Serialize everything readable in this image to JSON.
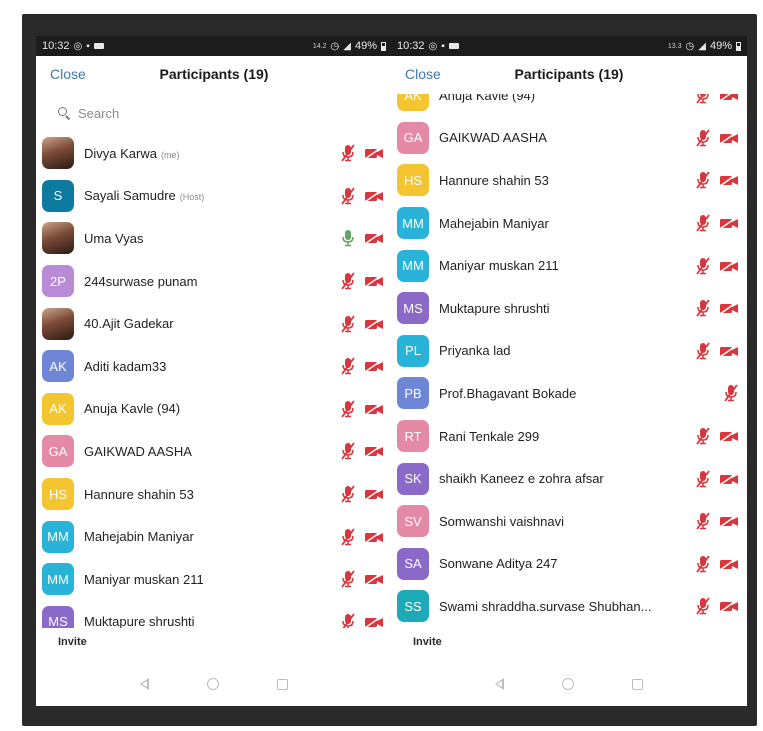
{
  "screens": [
    {
      "status": {
        "time": "10:32",
        "right_small": "14.2",
        "battery": "49%"
      },
      "header": {
        "close_label": "Close",
        "title": "Participants (19)"
      },
      "search": {
        "placeholder": "Search"
      },
      "participants": [
        {
          "name": "Divya Karwa",
          "role": "(me)",
          "initials": "",
          "photo": true,
          "color": "#8b5a46",
          "mic": "muted",
          "video": "off"
        },
        {
          "name": "Sayali Samudre",
          "role": "(Host)",
          "initials": "S",
          "photo": false,
          "color": "#0e7aa0",
          "mic": "muted",
          "video": "off"
        },
        {
          "name": "Uma Vyas",
          "role": "",
          "initials": "",
          "photo": true,
          "color": "#9a6a50",
          "mic": "on",
          "video": "off"
        },
        {
          "name": "244surwase punam",
          "role": "",
          "initials": "2P",
          "photo": false,
          "color": "#b98bd6",
          "mic": "muted",
          "video": "off"
        },
        {
          "name": "40.Ajit Gadekar",
          "role": "",
          "initials": "",
          "photo": true,
          "color": "#6b6b6b",
          "mic": "muted",
          "video": "off"
        },
        {
          "name": "Aditi kadam33",
          "role": "",
          "initials": "AK",
          "photo": false,
          "color": "#6d86d6",
          "mic": "muted",
          "video": "off"
        },
        {
          "name": "Anuja Kavle (94)",
          "role": "",
          "initials": "AK",
          "photo": false,
          "color": "#f2c531",
          "mic": "muted",
          "video": "off"
        },
        {
          "name": "GAIKWAD AASHA",
          "role": "",
          "initials": "GA",
          "photo": false,
          "color": "#e58aa6",
          "mic": "muted",
          "video": "off"
        },
        {
          "name": "Hannure shahin 53",
          "role": "",
          "initials": "HS",
          "photo": false,
          "color": "#f2c531",
          "mic": "muted",
          "video": "off"
        },
        {
          "name": "Mahejabin Maniyar",
          "role": "",
          "initials": "MM",
          "photo": false,
          "color": "#29b3d9",
          "mic": "muted",
          "video": "off"
        },
        {
          "name": "Maniyar muskan 211",
          "role": "",
          "initials": "MM",
          "photo": false,
          "color": "#29b3d9",
          "mic": "muted",
          "video": "off"
        },
        {
          "name": "Muktapure shrushti",
          "role": "",
          "initials": "MS",
          "photo": false,
          "color": "#8a69c9",
          "mic": "muted",
          "video": "off"
        }
      ],
      "footer": {
        "invite_label": "Invite"
      }
    },
    {
      "status": {
        "time": "10:32",
        "right_small": "13.3",
        "battery": "49%"
      },
      "header": {
        "close_label": "Close",
        "title": "Participants (19)"
      },
      "participants": [
        {
          "name": "Anuja Kavle (94)",
          "role": "",
          "initials": "AK",
          "photo": false,
          "color": "#f2c531",
          "mic": "muted",
          "video": "off"
        },
        {
          "name": "GAIKWAD AASHA",
          "role": "",
          "initials": "GA",
          "photo": false,
          "color": "#e58aa6",
          "mic": "muted",
          "video": "off"
        },
        {
          "name": "Hannure shahin 53",
          "role": "",
          "initials": "HS",
          "photo": false,
          "color": "#f2c531",
          "mic": "muted",
          "video": "off"
        },
        {
          "name": "Mahejabin Maniyar",
          "role": "",
          "initials": "MM",
          "photo": false,
          "color": "#29b3d9",
          "mic": "muted",
          "video": "off"
        },
        {
          "name": "Maniyar muskan 211",
          "role": "",
          "initials": "MM",
          "photo": false,
          "color": "#29b3d9",
          "mic": "muted",
          "video": "off"
        },
        {
          "name": "Muktapure shrushti",
          "role": "",
          "initials": "MS",
          "photo": false,
          "color": "#8a69c9",
          "mic": "muted",
          "video": "off"
        },
        {
          "name": "Priyanka lad",
          "role": "",
          "initials": "PL",
          "photo": false,
          "color": "#29b3d9",
          "mic": "muted",
          "video": "off"
        },
        {
          "name": "Prof.Bhagavant Bokade",
          "role": "",
          "initials": "PB",
          "photo": false,
          "color": "#6d86d6",
          "mic": "muted",
          "video": "none"
        },
        {
          "name": "Rani Tenkale 299",
          "role": "",
          "initials": "RT",
          "photo": false,
          "color": "#e58aa6",
          "mic": "muted",
          "video": "off"
        },
        {
          "name": "shaikh Kaneez e zohra afsar",
          "role": "",
          "initials": "SK",
          "photo": false,
          "color": "#8a69c9",
          "mic": "muted",
          "video": "off"
        },
        {
          "name": "Somwanshi vaishnavi",
          "role": "",
          "initials": "SV",
          "photo": false,
          "color": "#e58aa6",
          "mic": "muted",
          "video": "off"
        },
        {
          "name": "Sonwane Aditya 247",
          "role": "",
          "initials": "SA",
          "photo": false,
          "color": "#8a69c9",
          "mic": "muted",
          "video": "off"
        },
        {
          "name": "Swami shraddha.survase Shubhan...",
          "role": "",
          "initials": "SS",
          "photo": false,
          "color": "#1ea9b9",
          "mic": "muted",
          "video": "off"
        }
      ],
      "footer": {
        "invite_label": "Invite"
      }
    }
  ],
  "colors": {
    "muted_icon": "#d9363e",
    "mic_on_icon": "#5fa65a",
    "link": "#3d7ab0"
  },
  "icons": {
    "mic_muted": "mic-muted-icon",
    "mic_on": "mic-on-icon",
    "video_off": "video-off-icon"
  }
}
